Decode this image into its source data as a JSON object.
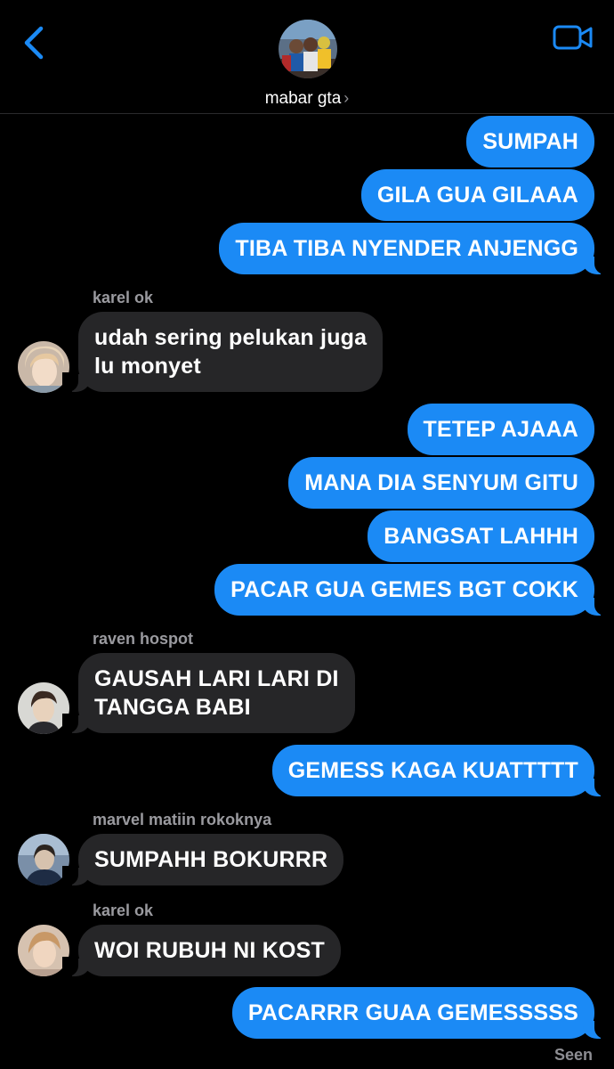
{
  "header": {
    "group_name": "mabar gta",
    "chevron": "›",
    "back_icon": "chevron-left-icon",
    "video_icon": "video-camera-icon",
    "accent": "#1b8af5"
  },
  "messages": [
    {
      "id": "m1",
      "type": "sent",
      "text": "SUMPAH"
    },
    {
      "id": "m2",
      "type": "sent",
      "text": "GILA GUA GILAAA"
    },
    {
      "id": "m3",
      "type": "sent",
      "text": "TIBA TIBA NYENDER ANJENGG"
    },
    {
      "id": "m4",
      "type": "received",
      "sender": "karel ok",
      "text_lines": [
        "udah sering pelukan juga",
        "lu monyet"
      ]
    },
    {
      "id": "m5",
      "type": "sent",
      "text": "TETEP AJAAA"
    },
    {
      "id": "m6",
      "type": "sent",
      "text": "MANA DIA SENYUM GITU"
    },
    {
      "id": "m7",
      "type": "sent",
      "text": "BANGSAT LAHHH"
    },
    {
      "id": "m8",
      "type": "sent",
      "text": "PACAR GUA GEMES BGT COKK"
    },
    {
      "id": "m9",
      "type": "received",
      "sender": "raven hospot",
      "text_lines": [
        "GAUSAH LARI LARI DI",
        "TANGGA BABI"
      ]
    },
    {
      "id": "m10",
      "type": "sent",
      "text": "GEMESS KAGA KUATTTTT"
    },
    {
      "id": "m11",
      "type": "received",
      "sender": "marvel matiin rokoknya",
      "text": "SUMPAHH BOKURRR"
    },
    {
      "id": "m12",
      "type": "received",
      "sender": "karel ok",
      "text": "WOI RUBUH NI KOST"
    },
    {
      "id": "m13",
      "type": "sent",
      "text": "PACARRR GUAA GEMESSSSS"
    }
  ],
  "status": {
    "seen": "Seen"
  },
  "colors": {
    "sent_bubble": "#1b8af5",
    "received_bubble": "#262628",
    "background": "#000000"
  }
}
